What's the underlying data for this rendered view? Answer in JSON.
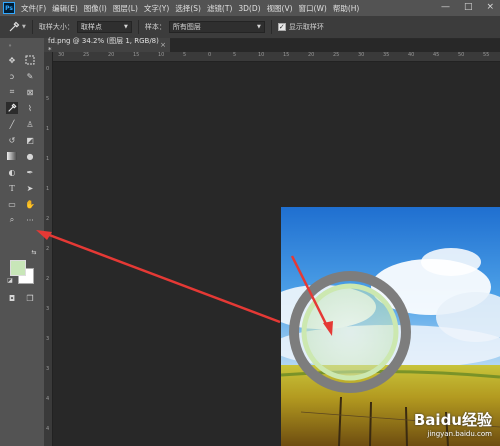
{
  "app": {
    "logo": "Ps"
  },
  "menu": [
    "文件(F)",
    "编辑(E)",
    "图像(I)",
    "图层(L)",
    "文字(Y)",
    "选择(S)",
    "滤镜(T)",
    "3D(D)",
    "视图(V)",
    "窗口(W)",
    "帮助(H)"
  ],
  "window_controls": [
    "—",
    "□",
    "×"
  ],
  "options": {
    "sample_size_label": "取样大小：",
    "sample_size_value": "取样点",
    "sample_label": "样本：",
    "sample_value": "所有图层",
    "show_ring_label": "显示取样环",
    "show_ring_checked": true
  },
  "document": {
    "tab_title": "fd.png @ 34.2% (图层 1, RGB/8) *",
    "close": "×"
  },
  "ruler_h_ticks": [
    "30",
    "25",
    "20",
    "15",
    "10",
    "5",
    "0",
    "5",
    "10",
    "15",
    "20",
    "25",
    "30",
    "35",
    "40",
    "45",
    "50",
    "55"
  ],
  "ruler_v_ticks": [
    "0",
    "5",
    "1",
    "1",
    "1",
    "2",
    "2",
    "2",
    "3",
    "3",
    "3",
    "4",
    "4"
  ],
  "colors": {
    "foreground": "#c8e6b8",
    "background": "#ffffff",
    "arrow": "#e53935"
  },
  "watermark": {
    "brand": "Baidu经验",
    "url": "jingyan.baidu.com"
  }
}
